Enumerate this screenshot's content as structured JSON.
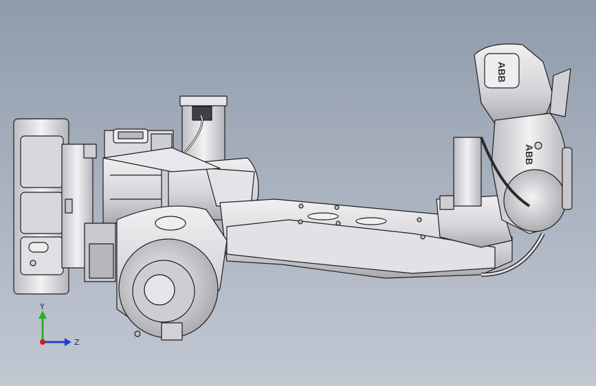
{
  "viewport": {
    "background_top": "#8f9bab",
    "background_bottom": "#c2c8d2"
  },
  "model": {
    "brand_logo": "ABB",
    "part_color": "#dcdcdf",
    "edge_color": "#1e1e1e"
  },
  "triad": {
    "y_label": "Y",
    "z_label": "Z",
    "y_color": "#2fae2f",
    "z_color": "#1f3fd0",
    "origin_color": "#c02020"
  }
}
